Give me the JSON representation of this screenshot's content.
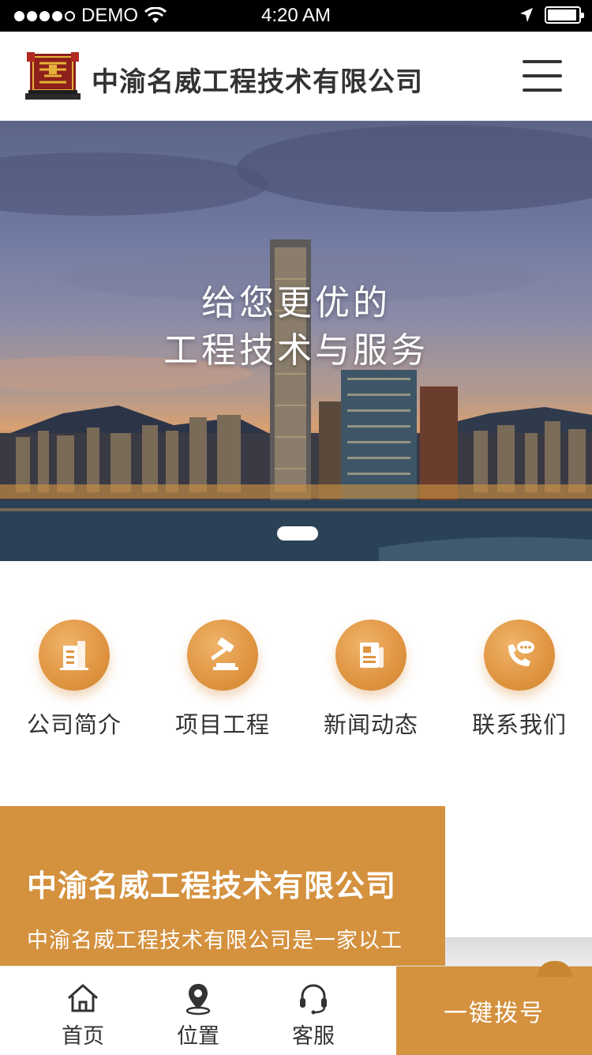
{
  "status_bar": {
    "carrier": "DEMO",
    "time": "4:20 AM",
    "signal_bars": 4,
    "battery_level": 0.9
  },
  "header": {
    "title": "中渝名威工程技术有限公司",
    "menu_icon": "hamburger-menu-icon",
    "logo_icon": "company-logo"
  },
  "banner": {
    "line1": "给您更优的",
    "line2": "工程技术与服务",
    "slide_count": 1,
    "active_slide": 1
  },
  "quick_nav": {
    "items": [
      {
        "label": "公司简介",
        "icon": "building-icon"
      },
      {
        "label": "项目工程",
        "icon": "gavel-icon"
      },
      {
        "label": "新闻动态",
        "icon": "news-document-icon"
      },
      {
        "label": "联系我们",
        "icon": "phone-chat-icon"
      }
    ]
  },
  "about": {
    "title": "中渝名威工程技术有限公司",
    "text": "中渝名威工程技术有限公司是一家以工"
  },
  "bottom_bar": {
    "tabs": [
      {
        "label": "首页",
        "icon": "home-icon"
      },
      {
        "label": "位置",
        "icon": "location-pin-icon"
      },
      {
        "label": "客服",
        "icon": "headset-icon"
      }
    ],
    "call_label": "一键拨号"
  },
  "colors": {
    "accent": "#d4913e",
    "icon_gradient": "#e29a4a"
  }
}
